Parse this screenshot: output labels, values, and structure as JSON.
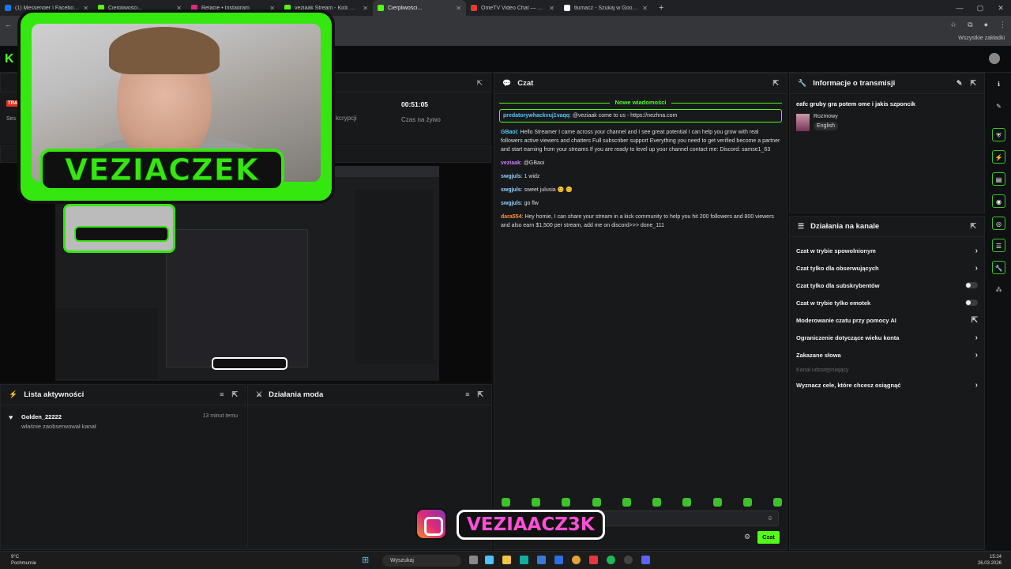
{
  "browser": {
    "tabs": [
      {
        "label": "(1) Messenger | Facebook",
        "color": "#1877f2"
      },
      {
        "label": "Cierpliwości...",
        "color": "#53fc18"
      },
      {
        "label": "Relacje • Instagram",
        "color": "#dd2a7b"
      },
      {
        "label": "veziaak Stream - Kick Dashboa...",
        "color": "#53fc18"
      },
      {
        "label": "Cierpliwości...",
        "color": "#53fc18",
        "active": true
      },
      {
        "label": "OmeTV Video Chat — Omegle...",
        "color": "#e53935"
      },
      {
        "label": "tłumacz - Szukaj w Google",
        "color": "#ffffff"
      }
    ],
    "bookmarks_right": "Wszystkie zakładki"
  },
  "kick": {
    "logo": "K"
  },
  "stream": {
    "timer": "00:51:05",
    "timer_label": "Czas na żywo",
    "subs_label": "kcrypcji",
    "left_badge": "TRA",
    "left_label": "Ses"
  },
  "overlay": {
    "cam_name": "VEZIACZEK",
    "ig_handle": "VEZIAACZ3K"
  },
  "activity": {
    "title": "Lista aktywności",
    "items": [
      {
        "name": "Golden_22222",
        "action": "właśnie zaobserwował kanał",
        "time": "13 minut temu"
      }
    ]
  },
  "mod_actions": {
    "title": "Działania moda"
  },
  "chat": {
    "title": "Czat",
    "new_messages": "Nowe wiadomości",
    "messages": [
      {
        "user": "predatorywhackvuj1vaqq",
        "color": "#53c8ff",
        "text": "@veziaak come to us - https://nezhna.com",
        "highlight": true
      },
      {
        "user": "GBaoi",
        "color": "#53c8ff",
        "text": "Hello Streamer I came across your channel and I see great potential I can help you grow with real followers active viewers and chatters Full subscriber support Everything you need to get verified become a partner and start earning from your streams If you are ready to level up your channel contact me: Discord: samse1_63"
      },
      {
        "user": "veziaak",
        "color": "#d07aff",
        "text": "@GBaoi"
      },
      {
        "user": "swgjuls",
        "color": "#8fd3ff",
        "text": "1 widz"
      },
      {
        "user": "swgjuls",
        "color": "#8fd3ff",
        "text": "sweet julusia 😊 😊"
      },
      {
        "user": "swgjuls",
        "color": "#8fd3ff",
        "text": "go flw"
      },
      {
        "user": "dara554",
        "color": "#ff8c3a",
        "text": "Hey homie, I can share your stream in a kick community to help you hit 200 followers and 800 viewers and also earn $1,500 per stream, add me on discord>>> done_111"
      }
    ],
    "send_label": "Czat"
  },
  "stream_info": {
    "title": "Informacje o transmisji",
    "stream_title": "eafc gruby gra potem ome i jakis szponcik",
    "category": "Rozmowy",
    "tag": "English"
  },
  "channel_actions": {
    "title": "Działania na kanale",
    "rows": [
      {
        "label": "Czat w trybie spowolnionym",
        "control": "arrow"
      },
      {
        "label": "Czat tylko dla obserwujących",
        "control": "arrow"
      },
      {
        "label": "Czat tylko dla subskrybentów",
        "control": "toggle"
      },
      {
        "label": "Czat w trybie tylko emotek",
        "control": "toggle"
      },
      {
        "label": "Moderowanie czatu przy pomocy AI",
        "control": "external"
      },
      {
        "label": "Ograniczenie dotyczące wieku konta",
        "control": "arrow"
      },
      {
        "label": "Zakazane słowa",
        "control": "arrow"
      },
      {
        "label": "Kanał udostępniający",
        "control": "none",
        "dim": true
      },
      {
        "label": "Wyznacz cele, które chcesz osiągnąć",
        "control": "arrow"
      }
    ]
  },
  "taskbar": {
    "weather_temp": "9°C",
    "weather_desc": "Pochmurnie",
    "search_placeholder": "Wyszukaj",
    "time": "15:24",
    "date": "26.03.2026"
  },
  "colors": {
    "accent": "#53fc18",
    "overlay_green": "#34e70f",
    "ig_pink": "#ff4fd8"
  }
}
